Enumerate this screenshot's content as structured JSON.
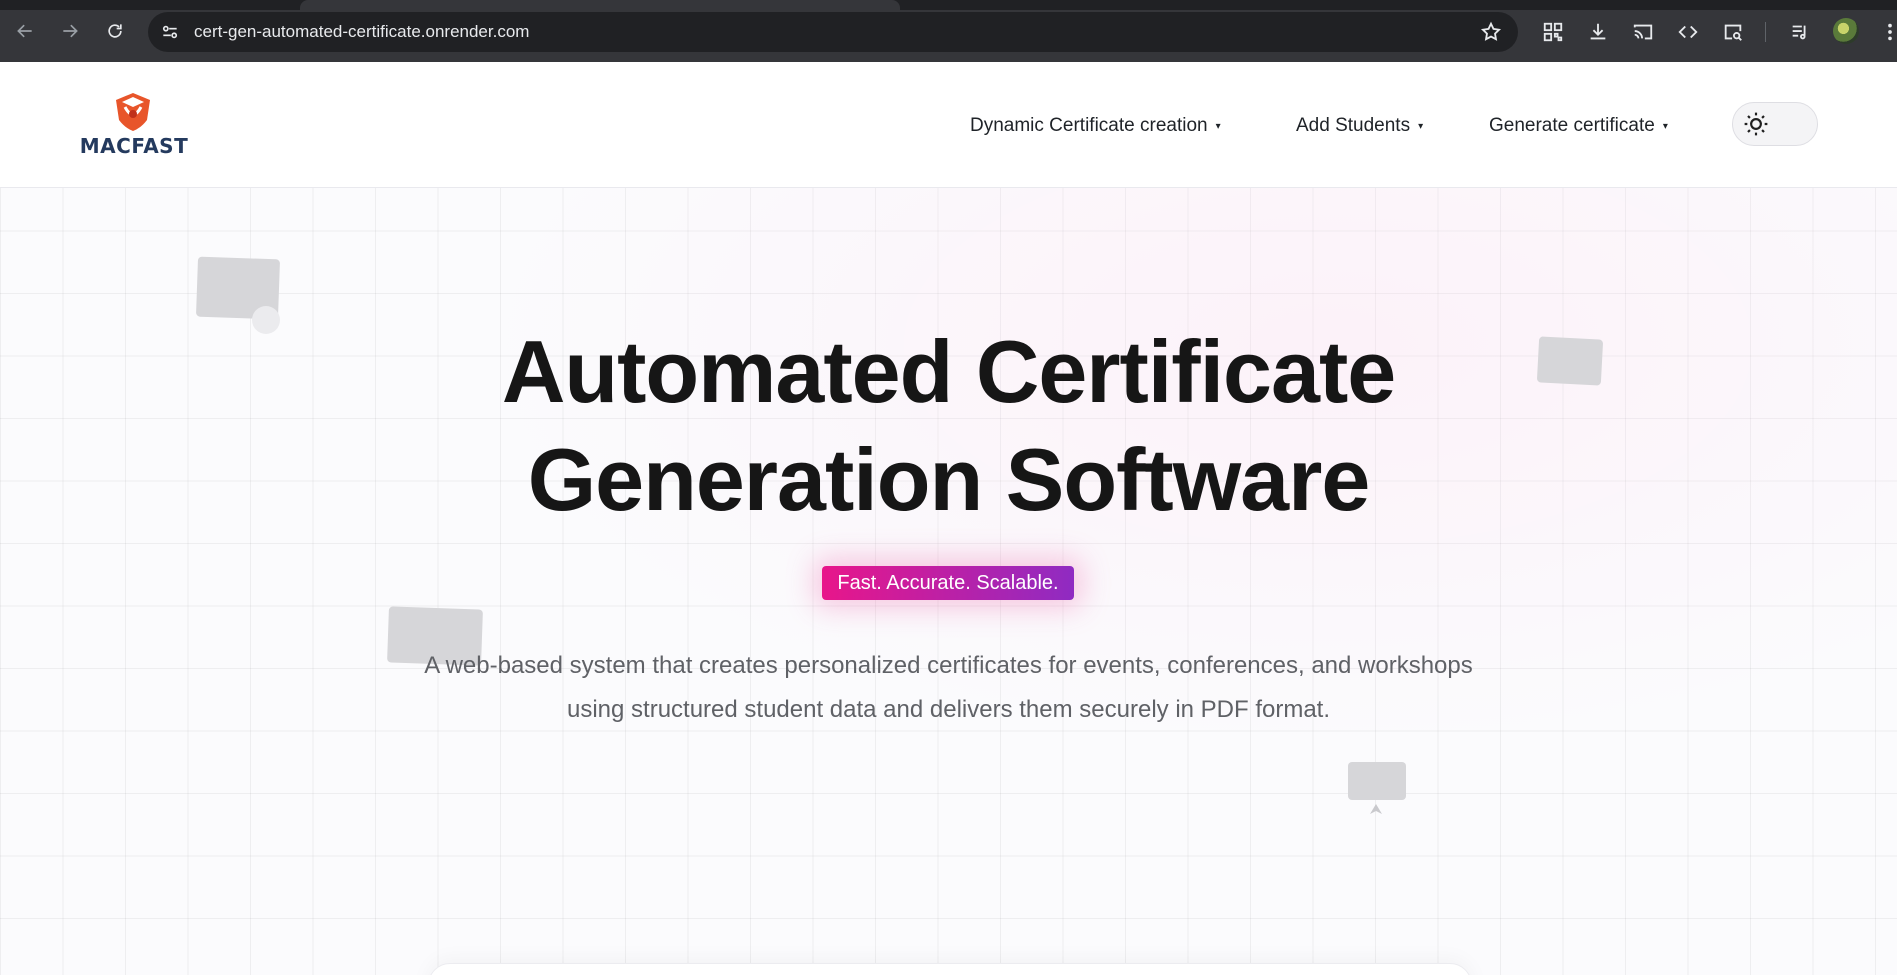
{
  "browser": {
    "url": "cert-gen-automated-certificate.onrender.com",
    "icons": [
      "back-icon",
      "forward-icon",
      "reload-icon",
      "site-info-icon",
      "bookmark-star-icon",
      "qr-code-icon",
      "download-icon",
      "cast-icon",
      "devtools-code-icon",
      "search-page-icon",
      "reading-list-icon",
      "profile-avatar",
      "menu-kebab-icon"
    ]
  },
  "site": {
    "brand": "MACFAST",
    "nav": [
      {
        "label": "Dynamic Certificate creation",
        "caret": "▾"
      },
      {
        "label": "Add Students",
        "caret": "▾"
      },
      {
        "label": "Generate certificate",
        "caret": "▾"
      }
    ],
    "theme_icon": "sun-icon"
  },
  "hero": {
    "title_line1": "Automated Certificate",
    "title_line2": "Generation Software",
    "tagline": "Fast. Accurate. Scalable.",
    "description": "A web-based system that creates personalized certificates for events, conferences, and workshops using structured student data and delivers them securely in PDF format."
  },
  "colors": {
    "tagline_gradient_start": "#e8168a",
    "tagline_gradient_end": "#8f2bc2",
    "brand_text": "#243a5e",
    "logo_orange": "#e8552a"
  }
}
